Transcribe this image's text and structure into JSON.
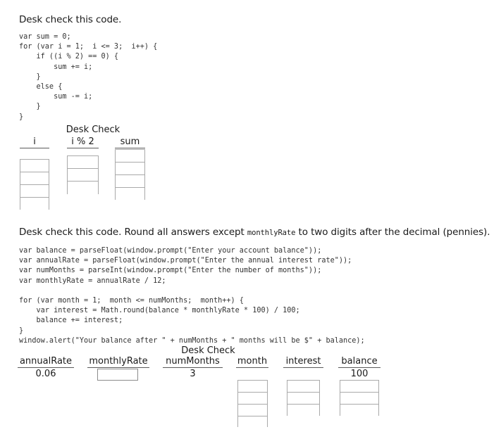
{
  "section1": {
    "prompt": "Desk check this code.",
    "code": "var sum = 0;\nfor (var i = 1;  i <= 3;  i++) {\n    if ((i % 2) == 0) {\n        sum += i;\n    }\n    else {\n        sum -= i;\n    }\n}",
    "table": {
      "title": "Desk Check",
      "columns": [
        {
          "header": "i",
          "value": "",
          "rows": 4
        },
        {
          "header": "i % 2",
          "value": "",
          "rows": 3
        },
        {
          "header": "sum",
          "value": "",
          "rows": 4
        }
      ]
    }
  },
  "section2": {
    "prompt_part1": "Desk check this code. Round all answers except ",
    "prompt_mono": "monthlyRate",
    "prompt_part2": " to two digits after the decimal (pennies).",
    "code": "var balance = parseFloat(window.prompt(\"Enter your account balance\"));\nvar annualRate = parseFloat(window.prompt(\"Enter the annual interest rate\"));\nvar numMonths = parseInt(window.prompt(\"Enter the number of months\"));\nvar monthlyRate = annualRate / 12;\n\nfor (var month = 1;  month <= numMonths;  month++) {\n    var interest = Math.round(balance * monthlyRate * 100) / 100;\n    balance += interest;\n}\nwindow.alert(\"Your balance after \" + numMonths + \" months will be $\" + balance);",
    "table": {
      "title": "Desk Check",
      "columns": [
        {
          "header": "annualRate",
          "value": "0.06",
          "rows": 0
        },
        {
          "header": "monthlyRate",
          "value": "",
          "rows": 0,
          "input": true,
          "input_value": ""
        },
        {
          "header": "numMonths",
          "value": "3",
          "rows": 0
        },
        {
          "header": "month",
          "value": "",
          "rows": 4
        },
        {
          "header": "interest",
          "value": "",
          "rows": 3
        },
        {
          "header": "balance",
          "value": "100",
          "rows": 3
        }
      ]
    }
  },
  "colors": {
    "box_border": "#a9a9a9",
    "header_rule": "#5a5a5a",
    "input_border": "#8c8c8c",
    "text": "#1a1a1a",
    "code_text": "#333333",
    "background": "#ffffff"
  }
}
